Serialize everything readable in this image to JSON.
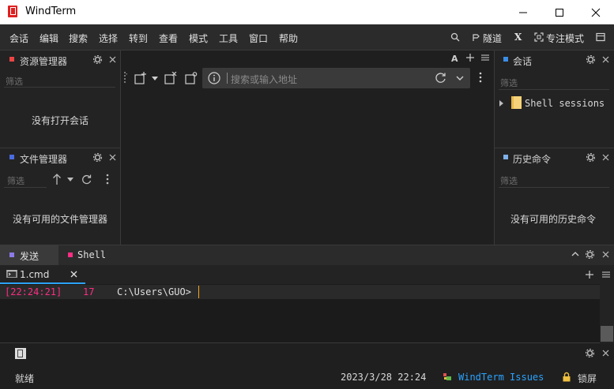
{
  "window": {
    "title": "WindTerm"
  },
  "menu": {
    "items": [
      "会话",
      "编辑",
      "搜索",
      "选择",
      "转到",
      "查看",
      "模式",
      "工具",
      "窗口",
      "帮助"
    ],
    "tunnel_label": "隧道",
    "x_label": "X",
    "focus_label": "专注模式"
  },
  "left_top_panel": {
    "title": "资源管理器",
    "filter_placeholder": "筛选",
    "empty_text": "没有打开会话"
  },
  "left_bottom_panel": {
    "title": "文件管理器",
    "filter_placeholder": "筛选",
    "empty_text": "没有可用的文件管理器"
  },
  "center": {
    "address_placeholder": "搜索或输入地址",
    "font_label": "A"
  },
  "right_top_panel": {
    "title": "会话",
    "filter_placeholder": "筛选",
    "tree_item": "Shell sessions"
  },
  "right_bottom_panel": {
    "title": "历史命令",
    "filter_placeholder": "筛选",
    "empty_text": "没有可用的历史命令"
  },
  "bottom_tabs": {
    "send_label": "发送",
    "shell_label": "Shell"
  },
  "session_tab": {
    "label": "1.cmd"
  },
  "terminal": {
    "timestamp": "[22:24:21]",
    "line_no": "17",
    "prompt": "C:\\Users\\GUO>"
  },
  "status_bar": {
    "ready": "就绪",
    "datetime": "2023/3/28 22:24",
    "issues_link": "WindTerm Issues",
    "lock_label": "锁屏"
  },
  "colors": {
    "accent": "#2aa3ff",
    "terminal_pink": "#ff2d83",
    "prompt_cursor": "#f5a623"
  }
}
